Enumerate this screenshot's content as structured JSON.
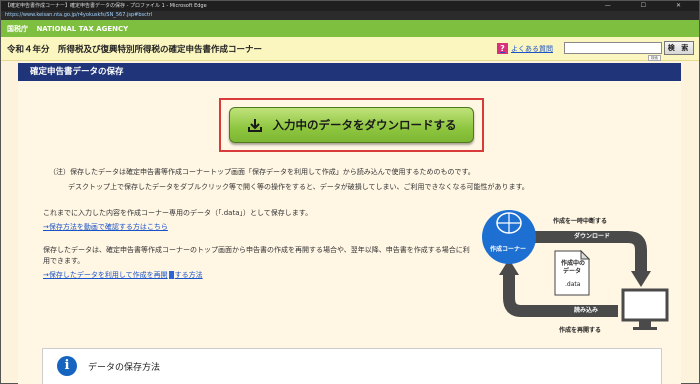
{
  "browser": {
    "title": "【確定申告書作成コーナー】確定申告書データの保存 - プロファイル 1 - Microsoft Edge",
    "address": "https://www.keisan.nta.go.jp/r4yokuskfs/SN_567.jsp#bsctrl",
    "controls": "—  ☐  ✕"
  },
  "nta_header": {
    "mark": "国税庁",
    "name": "NATIONAL TAX AGENCY"
  },
  "subheader": {
    "title": "令和４年分　所得税及び復興特別所得税の確定申告書作成コーナー",
    "faq_label": "よくある質問",
    "search_button": "検 索",
    "tip": "検索"
  },
  "section": {
    "title": "確定申告書データの保存"
  },
  "save_button": {
    "label": "入力中のデータをダウンロードする"
  },
  "notes": {
    "line1": "（注）保存したデータは確定申告書等作成コーナートップ画面「保存データを利用して作成」から読み込んで使用するためのものです。",
    "line2": "デスクトップ上で保存したデータをダブルクリック等で開く等の操作をすると、データが破損してしまい、ご利用できなくなる可能性があります。"
  },
  "body": {
    "para1": "これまでに入力した内容を作成コーナー専用のデータ（「.data」）として保存します。",
    "link1": "→保存方法を動画で確認する方はこちら",
    "para2": "保存したデータは、確定申告書等作成コーナーのトップ画面から申告書の作成を再開する場合や、翌年以降、申告書を作成する場合に利用できます。",
    "link2_a": "→保存したデータを利用して作成を再開",
    "link2_b": "する方法"
  },
  "diagram": {
    "suspend_label": "作成を一時中断する",
    "download_tag": "ダウンロード",
    "corner_label": "作成コーナー",
    "file_label_1": "作成中の",
    "file_label_2": "データ",
    "file_ext": ".data",
    "read_tag": "読み込み",
    "resume_label": "作成を再開する"
  },
  "info": {
    "icon": "i",
    "title": "データの保存方法"
  },
  "colors": {
    "green_header": "#7fbf3f",
    "navy_section": "#1f3479",
    "highlight_red": "#d93b3b",
    "button_green": "#8ec63f",
    "link_blue": "#1a52c8",
    "globe_blue": "#1d6fd1"
  }
}
